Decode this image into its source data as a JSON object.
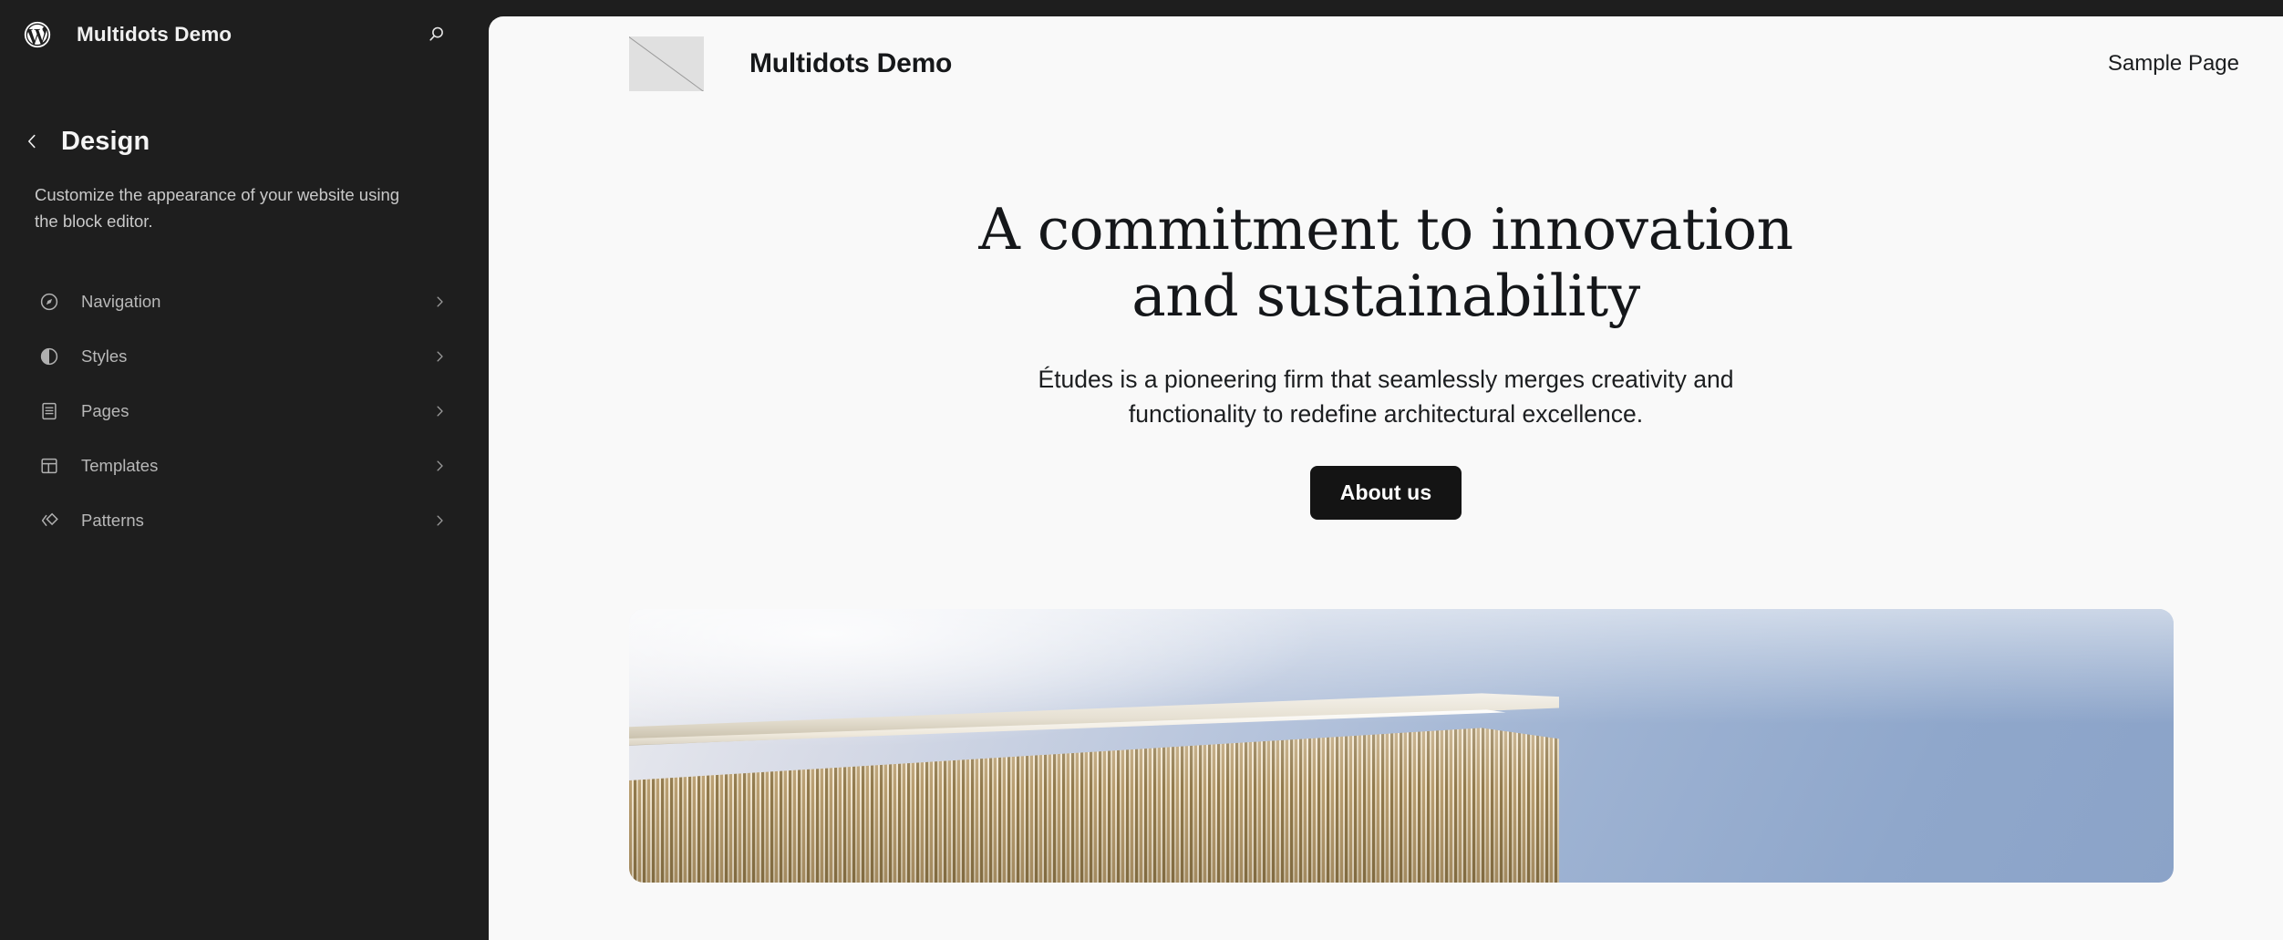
{
  "theme": {
    "sidebar_bg": "#1e1e1e",
    "canvas_bg": "#f9f9f9",
    "button_bg": "#141414",
    "accent_text": "#f0f0f0"
  },
  "sidebar": {
    "logo_icon": "wordpress-logo-icon",
    "site_title": "Multidots Demo",
    "search_icon": "search-icon",
    "back_icon": "chevron-left-icon",
    "panel_title": "Design",
    "panel_description": "Customize the appearance of your website using the block editor.",
    "items": [
      {
        "label": "Navigation",
        "icon": "compass-icon",
        "chevron": "chevron-right-icon"
      },
      {
        "label": "Styles",
        "icon": "contrast-icon",
        "chevron": "chevron-right-icon"
      },
      {
        "label": "Pages",
        "icon": "page-icon",
        "chevron": "chevron-right-icon"
      },
      {
        "label": "Templates",
        "icon": "layout-icon",
        "chevron": "chevron-right-icon"
      },
      {
        "label": "Patterns",
        "icon": "patterns-icon",
        "chevron": "chevron-right-icon"
      }
    ]
  },
  "preview": {
    "header": {
      "logo_placeholder": "broken-image-placeholder",
      "site_name": "Multidots Demo",
      "nav_links": [
        {
          "label": "Sample Page"
        }
      ]
    },
    "hero": {
      "title": "A commitment to innovation and sustainability",
      "subtitle": "Études is a pioneering firm that seamlessly merges creativity and functionality to redefine architectural excellence.",
      "button_label": "About us",
      "image_alt": "Modern architectural building corner with vertical wooden fins against a blue sky"
    }
  }
}
